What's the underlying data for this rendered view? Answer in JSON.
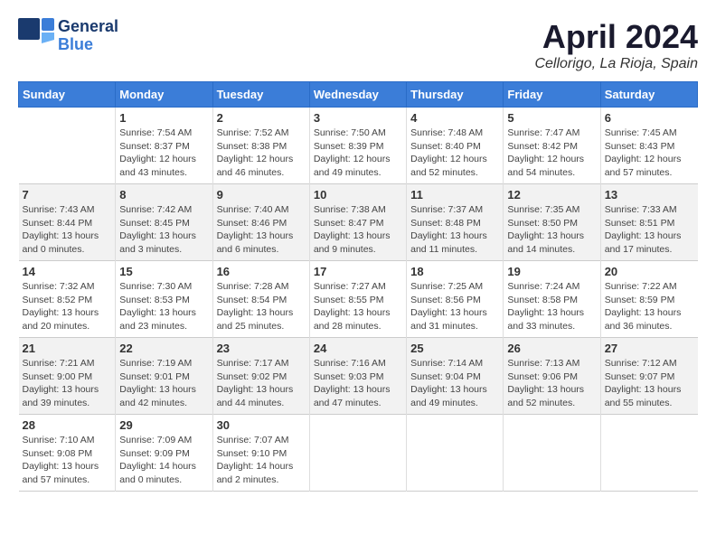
{
  "logo": {
    "line1": "General",
    "line2": "Blue"
  },
  "title": "April 2024",
  "subtitle": "Cellorigo, La Rioja, Spain",
  "days": [
    "Sunday",
    "Monday",
    "Tuesday",
    "Wednesday",
    "Thursday",
    "Friday",
    "Saturday"
  ],
  "weeks": [
    [
      {
        "num": "",
        "lines": []
      },
      {
        "num": "1",
        "lines": [
          "Sunrise: 7:54 AM",
          "Sunset: 8:37 PM",
          "Daylight: 12 hours",
          "and 43 minutes."
        ]
      },
      {
        "num": "2",
        "lines": [
          "Sunrise: 7:52 AM",
          "Sunset: 8:38 PM",
          "Daylight: 12 hours",
          "and 46 minutes."
        ]
      },
      {
        "num": "3",
        "lines": [
          "Sunrise: 7:50 AM",
          "Sunset: 8:39 PM",
          "Daylight: 12 hours",
          "and 49 minutes."
        ]
      },
      {
        "num": "4",
        "lines": [
          "Sunrise: 7:48 AM",
          "Sunset: 8:40 PM",
          "Daylight: 12 hours",
          "and 52 minutes."
        ]
      },
      {
        "num": "5",
        "lines": [
          "Sunrise: 7:47 AM",
          "Sunset: 8:42 PM",
          "Daylight: 12 hours",
          "and 54 minutes."
        ]
      },
      {
        "num": "6",
        "lines": [
          "Sunrise: 7:45 AM",
          "Sunset: 8:43 PM",
          "Daylight: 12 hours",
          "and 57 minutes."
        ]
      }
    ],
    [
      {
        "num": "7",
        "lines": [
          "Sunrise: 7:43 AM",
          "Sunset: 8:44 PM",
          "Daylight: 13 hours",
          "and 0 minutes."
        ]
      },
      {
        "num": "8",
        "lines": [
          "Sunrise: 7:42 AM",
          "Sunset: 8:45 PM",
          "Daylight: 13 hours",
          "and 3 minutes."
        ]
      },
      {
        "num": "9",
        "lines": [
          "Sunrise: 7:40 AM",
          "Sunset: 8:46 PM",
          "Daylight: 13 hours",
          "and 6 minutes."
        ]
      },
      {
        "num": "10",
        "lines": [
          "Sunrise: 7:38 AM",
          "Sunset: 8:47 PM",
          "Daylight: 13 hours",
          "and 9 minutes."
        ]
      },
      {
        "num": "11",
        "lines": [
          "Sunrise: 7:37 AM",
          "Sunset: 8:48 PM",
          "Daylight: 13 hours",
          "and 11 minutes."
        ]
      },
      {
        "num": "12",
        "lines": [
          "Sunrise: 7:35 AM",
          "Sunset: 8:50 PM",
          "Daylight: 13 hours",
          "and 14 minutes."
        ]
      },
      {
        "num": "13",
        "lines": [
          "Sunrise: 7:33 AM",
          "Sunset: 8:51 PM",
          "Daylight: 13 hours",
          "and 17 minutes."
        ]
      }
    ],
    [
      {
        "num": "14",
        "lines": [
          "Sunrise: 7:32 AM",
          "Sunset: 8:52 PM",
          "Daylight: 13 hours",
          "and 20 minutes."
        ]
      },
      {
        "num": "15",
        "lines": [
          "Sunrise: 7:30 AM",
          "Sunset: 8:53 PM",
          "Daylight: 13 hours",
          "and 23 minutes."
        ]
      },
      {
        "num": "16",
        "lines": [
          "Sunrise: 7:28 AM",
          "Sunset: 8:54 PM",
          "Daylight: 13 hours",
          "and 25 minutes."
        ]
      },
      {
        "num": "17",
        "lines": [
          "Sunrise: 7:27 AM",
          "Sunset: 8:55 PM",
          "Daylight: 13 hours",
          "and 28 minutes."
        ]
      },
      {
        "num": "18",
        "lines": [
          "Sunrise: 7:25 AM",
          "Sunset: 8:56 PM",
          "Daylight: 13 hours",
          "and 31 minutes."
        ]
      },
      {
        "num": "19",
        "lines": [
          "Sunrise: 7:24 AM",
          "Sunset: 8:58 PM",
          "Daylight: 13 hours",
          "and 33 minutes."
        ]
      },
      {
        "num": "20",
        "lines": [
          "Sunrise: 7:22 AM",
          "Sunset: 8:59 PM",
          "Daylight: 13 hours",
          "and 36 minutes."
        ]
      }
    ],
    [
      {
        "num": "21",
        "lines": [
          "Sunrise: 7:21 AM",
          "Sunset: 9:00 PM",
          "Daylight: 13 hours",
          "and 39 minutes."
        ]
      },
      {
        "num": "22",
        "lines": [
          "Sunrise: 7:19 AM",
          "Sunset: 9:01 PM",
          "Daylight: 13 hours",
          "and 42 minutes."
        ]
      },
      {
        "num": "23",
        "lines": [
          "Sunrise: 7:17 AM",
          "Sunset: 9:02 PM",
          "Daylight: 13 hours",
          "and 44 minutes."
        ]
      },
      {
        "num": "24",
        "lines": [
          "Sunrise: 7:16 AM",
          "Sunset: 9:03 PM",
          "Daylight: 13 hours",
          "and 47 minutes."
        ]
      },
      {
        "num": "25",
        "lines": [
          "Sunrise: 7:14 AM",
          "Sunset: 9:04 PM",
          "Daylight: 13 hours",
          "and 49 minutes."
        ]
      },
      {
        "num": "26",
        "lines": [
          "Sunrise: 7:13 AM",
          "Sunset: 9:06 PM",
          "Daylight: 13 hours",
          "and 52 minutes."
        ]
      },
      {
        "num": "27",
        "lines": [
          "Sunrise: 7:12 AM",
          "Sunset: 9:07 PM",
          "Daylight: 13 hours",
          "and 55 minutes."
        ]
      }
    ],
    [
      {
        "num": "28",
        "lines": [
          "Sunrise: 7:10 AM",
          "Sunset: 9:08 PM",
          "Daylight: 13 hours",
          "and 57 minutes."
        ]
      },
      {
        "num": "29",
        "lines": [
          "Sunrise: 7:09 AM",
          "Sunset: 9:09 PM",
          "Daylight: 14 hours",
          "and 0 minutes."
        ]
      },
      {
        "num": "30",
        "lines": [
          "Sunrise: 7:07 AM",
          "Sunset: 9:10 PM",
          "Daylight: 14 hours",
          "and 2 minutes."
        ]
      },
      {
        "num": "",
        "lines": []
      },
      {
        "num": "",
        "lines": []
      },
      {
        "num": "",
        "lines": []
      },
      {
        "num": "",
        "lines": []
      }
    ]
  ]
}
